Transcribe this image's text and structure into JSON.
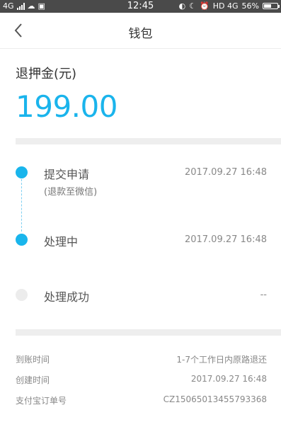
{
  "status_bar": {
    "network": "4G",
    "time": "12:45",
    "network_right": "HD 4G",
    "battery": "56%",
    "battery_level": 0.56
  },
  "navbar": {
    "title": "钱包"
  },
  "deposit": {
    "label": "退押金(元)",
    "amount": "199.00"
  },
  "timeline": {
    "steps": [
      {
        "label": "提交申请",
        "sub": "(退款至微信)",
        "time": "2017.09.27 16:48",
        "done": true
      },
      {
        "label": "处理中",
        "time": "2017.09.27 16:48",
        "done": true
      },
      {
        "label": "处理成功",
        "time": "--",
        "done": false
      }
    ]
  },
  "details": [
    {
      "label": "到账时间",
      "value": "1-7个工作日内原路退还"
    },
    {
      "label": "创建时间",
      "value": "2017.09.27 16:48"
    },
    {
      "label": "支付宝订单号",
      "value": "CZ15065013455793368"
    }
  ],
  "colors": {
    "accent": "#19b5ec",
    "status_bar_bg": "#4a4a4a",
    "divider": "#eeeeee"
  }
}
